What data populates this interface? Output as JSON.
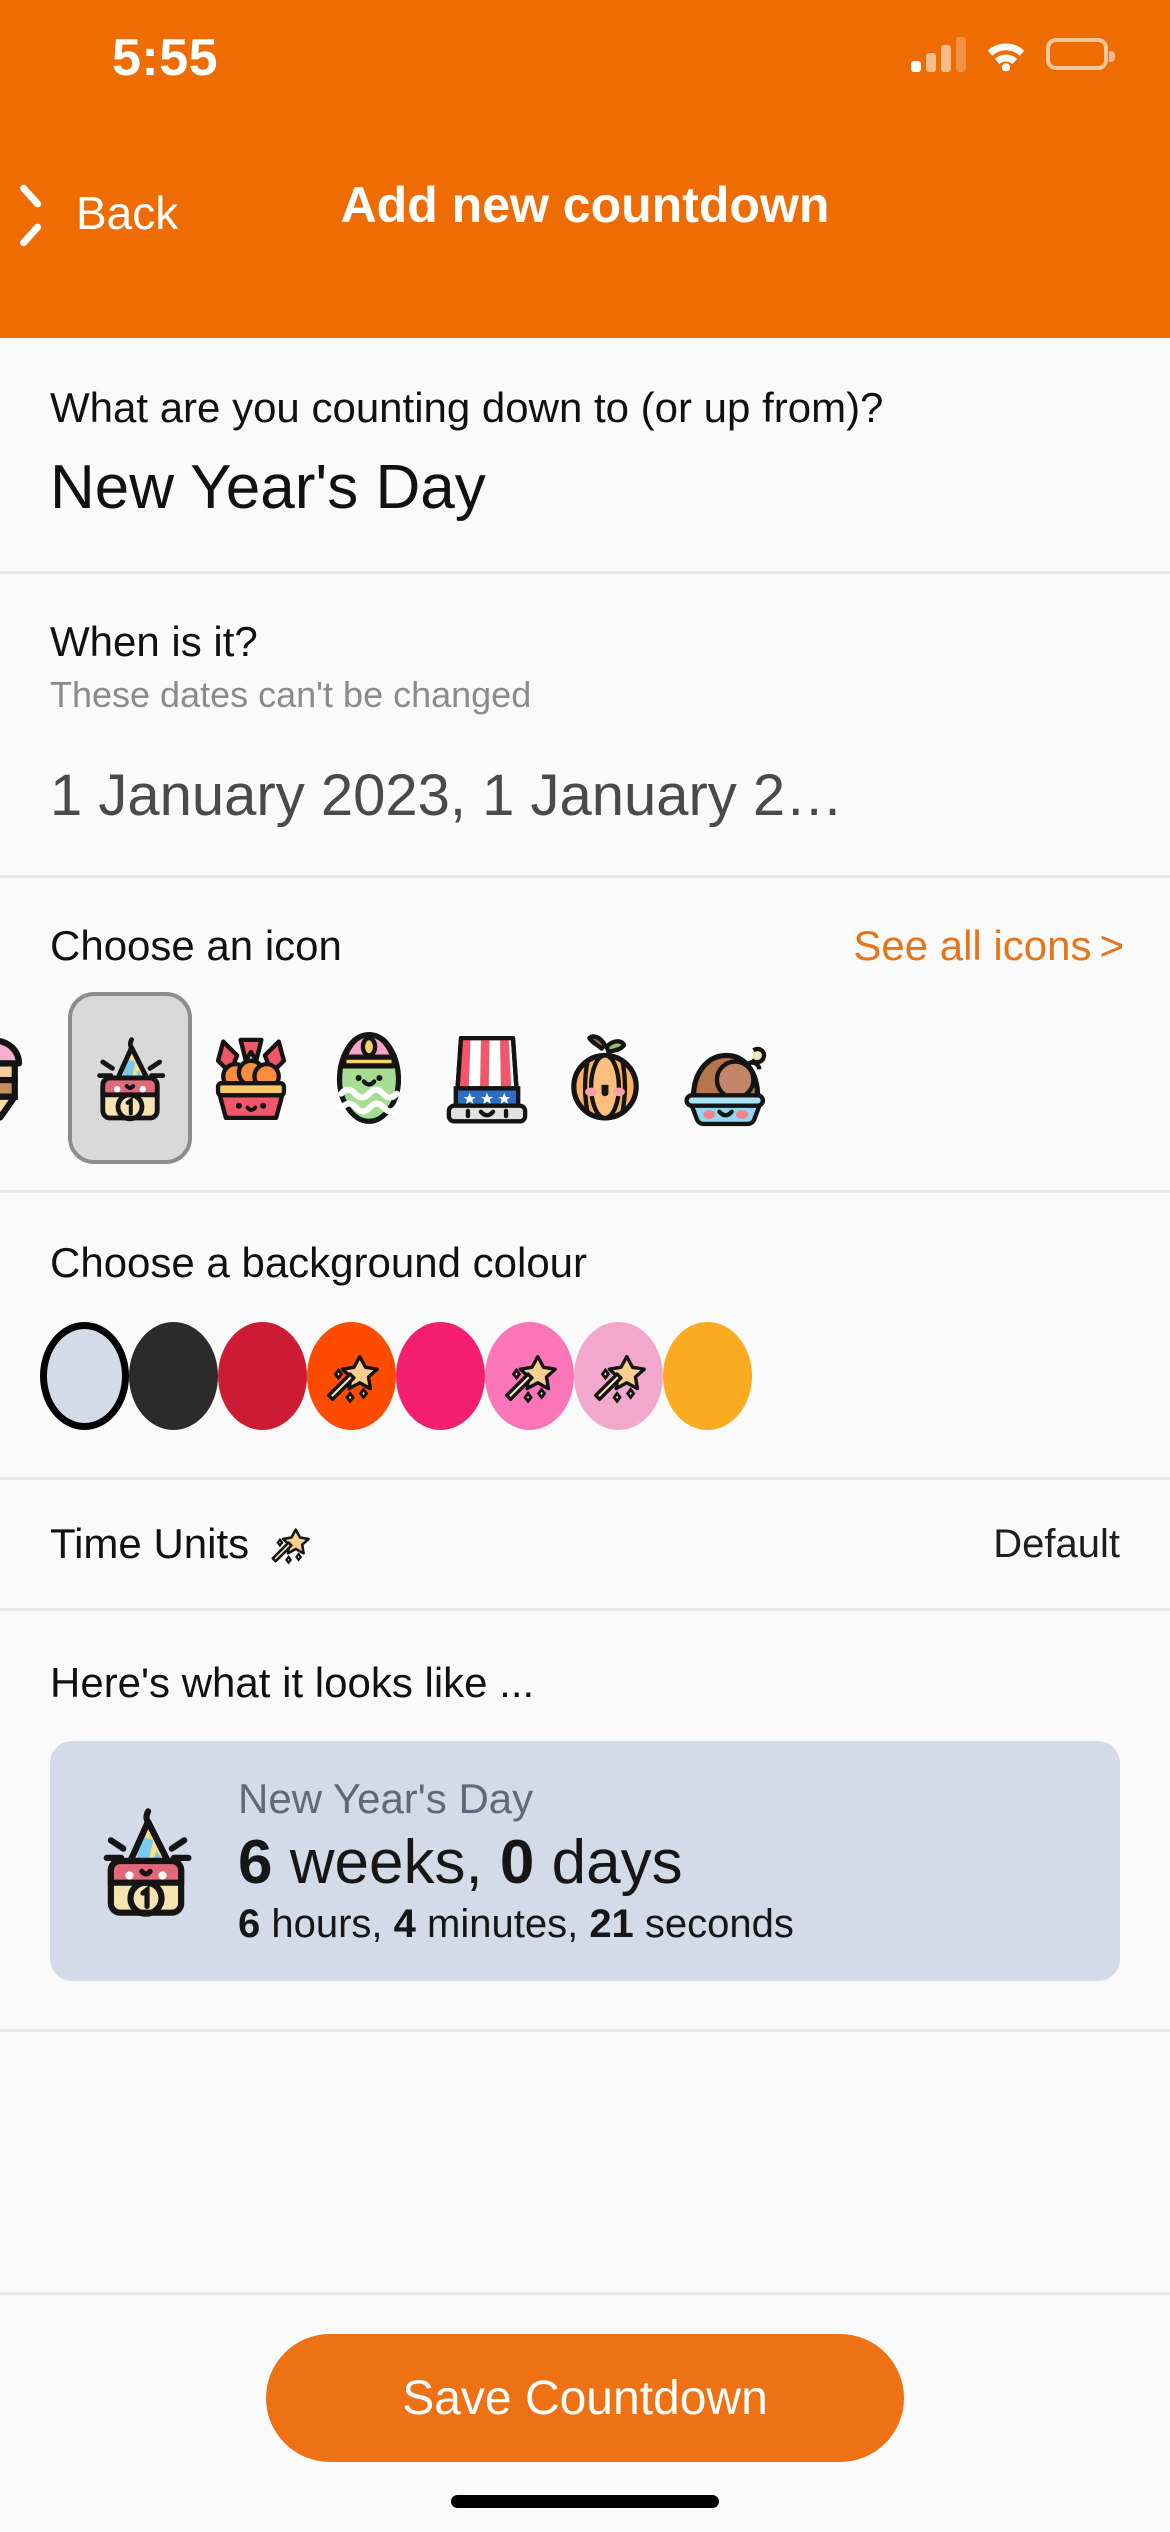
{
  "status_bar": {
    "time": "5:55",
    "signal_icon": "cellular-signal-icon",
    "wifi_icon": "wifi-icon",
    "battery_icon": "battery-low-power-icon",
    "battery_color": "#ffcc00"
  },
  "nav": {
    "back_label": "Back",
    "back_icon": "chevron-left-icon",
    "title": "Add new countdown",
    "bar_color": "#ee6c02"
  },
  "name_section": {
    "question": "What are you counting down to (or up from)?",
    "value": "New Year's Day",
    "placeholder": "New Year's Day"
  },
  "date_section": {
    "label": "When is it?",
    "sublabel": "These dates can't be changed",
    "value": "1 January 2023, 1 January 2…"
  },
  "icon_section": {
    "title": "Choose an icon",
    "see_all_label": "See all icons",
    "see_all_chevron": ">",
    "see_all_color": "#e8741a",
    "icons": [
      {
        "name": "ice-cream-icon",
        "selected": false,
        "partial": true
      },
      {
        "name": "new-year-calendar-icon",
        "selected": true,
        "partial": false
      },
      {
        "name": "easter-basket-icon",
        "selected": false,
        "partial": false
      },
      {
        "name": "easter-egg-icon",
        "selected": false,
        "partial": false
      },
      {
        "name": "uncle-sam-hat-icon",
        "selected": false,
        "partial": false
      },
      {
        "name": "pumpkin-icon",
        "selected": false,
        "partial": false
      },
      {
        "name": "roast-turkey-icon",
        "selected": false,
        "partial": true
      }
    ]
  },
  "colour_section": {
    "title": "Choose a background colour",
    "swatches": [
      {
        "name": "swatch-light-blue",
        "color": "#d3dbe9",
        "selected": true,
        "star": false
      },
      {
        "name": "swatch-black",
        "color": "#2b2b2b",
        "selected": false,
        "star": false
      },
      {
        "name": "swatch-crimson",
        "color": "#cc1b33",
        "selected": false,
        "star": false
      },
      {
        "name": "swatch-orange-red",
        "color": "#fd4b00",
        "selected": false,
        "star": true
      },
      {
        "name": "swatch-deep-pink",
        "color": "#f31f6e",
        "selected": false,
        "star": false
      },
      {
        "name": "swatch-pink",
        "color": "#fa76b8",
        "selected": false,
        "star": true
      },
      {
        "name": "swatch-light-pink",
        "color": "#f1a8cc",
        "selected": false,
        "star": true
      },
      {
        "name": "swatch-amber",
        "color": "#fbab20",
        "selected": false,
        "star": false
      }
    ]
  },
  "time_units": {
    "label": "Time Units",
    "badge_icon": "shooting-star-icon",
    "value": "Default"
  },
  "preview": {
    "heading": "Here's what it looks like ...",
    "card_color": "#d3dbe9",
    "icon": "new-year-calendar-icon",
    "title": "New Year's Day",
    "primary": [
      {
        "number": "6",
        "unit": "weeks,"
      },
      {
        "number": "0",
        "unit": "days"
      }
    ],
    "secondary": [
      {
        "number": "6",
        "unit": "hours,"
      },
      {
        "number": "4",
        "unit": "minutes,"
      },
      {
        "number": "21",
        "unit": "seconds"
      }
    ]
  },
  "footer": {
    "save_label": "Save Countdown",
    "save_color": "#ee7213",
    "home_indicator": "home-indicator"
  }
}
